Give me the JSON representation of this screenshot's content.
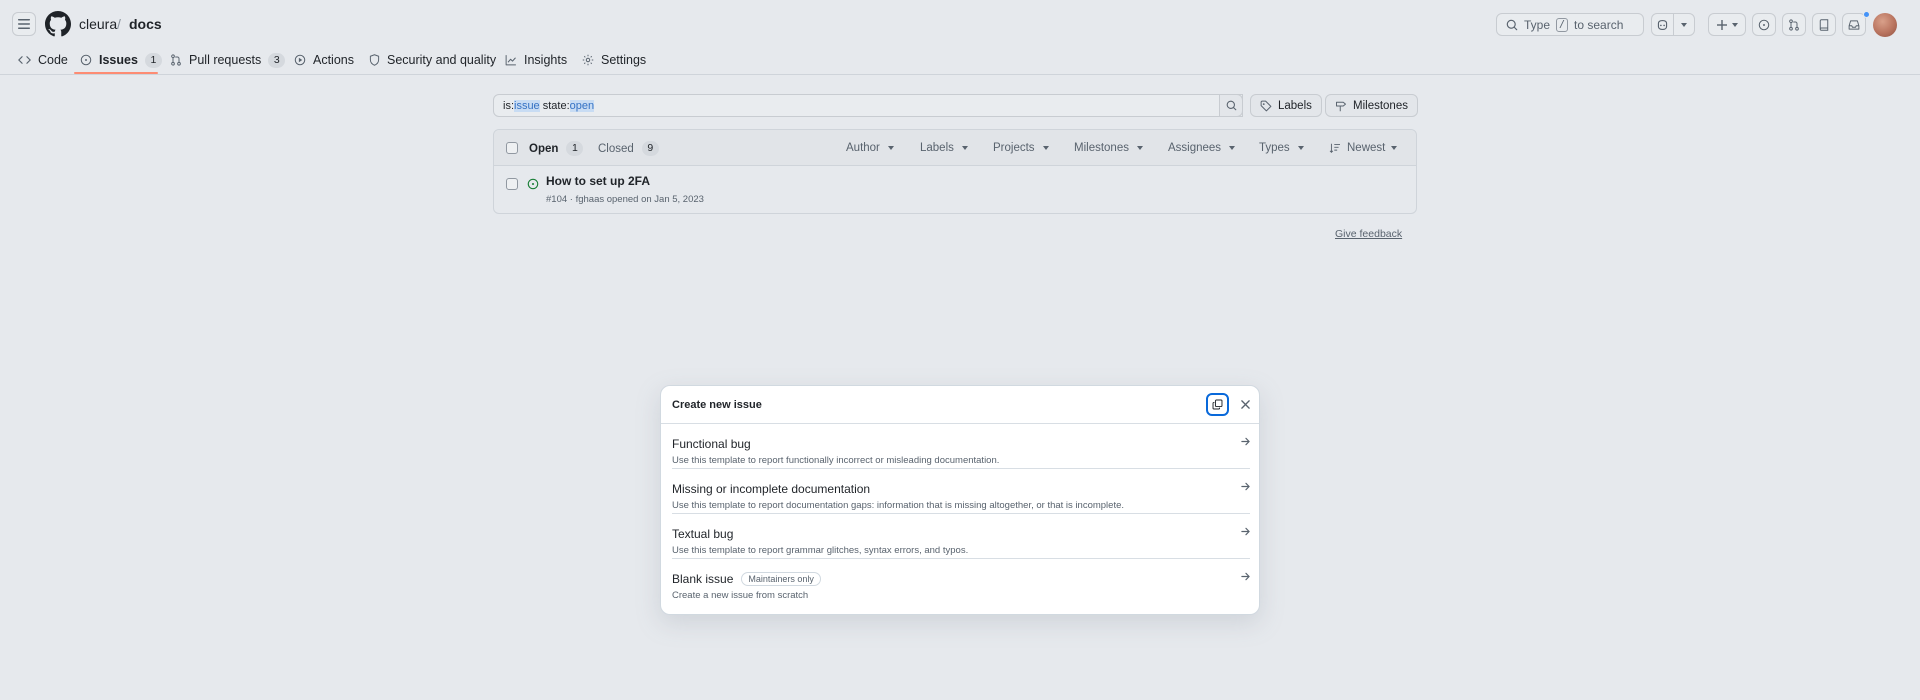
{
  "header": {
    "owner": "cleura",
    "separator": "/",
    "repo": "docs",
    "search": {
      "prefix": "Type",
      "key": "/",
      "suffix": "to search"
    }
  },
  "nav": {
    "code": "Code",
    "issues": "Issues",
    "issues_count": "1",
    "pull_requests": "Pull requests",
    "pull_requests_count": "3",
    "actions": "Actions",
    "security": "Security and quality",
    "insights": "Insights",
    "settings": "Settings"
  },
  "filter": {
    "query_prefix": "is:",
    "query_is_value": "issue",
    "query_state": " state:",
    "query_state_value": "open",
    "labels_button": "Labels",
    "milestones_button": "Milestones"
  },
  "issues": {
    "open_label": "Open",
    "open_count": "1",
    "closed_label": "Closed",
    "closed_count": "9",
    "filters": {
      "author": "Author",
      "labels": "Labels",
      "projects": "Projects",
      "milestones": "Milestones",
      "assignees": "Assignees",
      "types": "Types",
      "sort": "Newest"
    },
    "rows": [
      {
        "title": "How to set up 2FA",
        "meta": "#104 · fghaas opened on Jan 5, 2023"
      }
    ],
    "feedback": "Give feedback"
  },
  "dialog": {
    "title": "Create new issue",
    "templates": [
      {
        "name": "Functional bug",
        "description": "Use this template to report functionally incorrect or misleading documentation."
      },
      {
        "name": "Missing or incomplete documentation",
        "description": "Use this template to report documentation gaps: information that is missing altogether, or that is incomplete."
      },
      {
        "name": "Textual bug",
        "description": "Use this template to report grammar glitches, syntax errors, and typos."
      },
      {
        "name": "Blank issue",
        "badge": "Maintainers only",
        "description": "Create a new issue from scratch"
      }
    ]
  },
  "colors": {
    "accent": "#0969da",
    "nav_underline": "#fd8c73",
    "open_issue": "#1a7f37",
    "background": "#e6e9ed"
  }
}
